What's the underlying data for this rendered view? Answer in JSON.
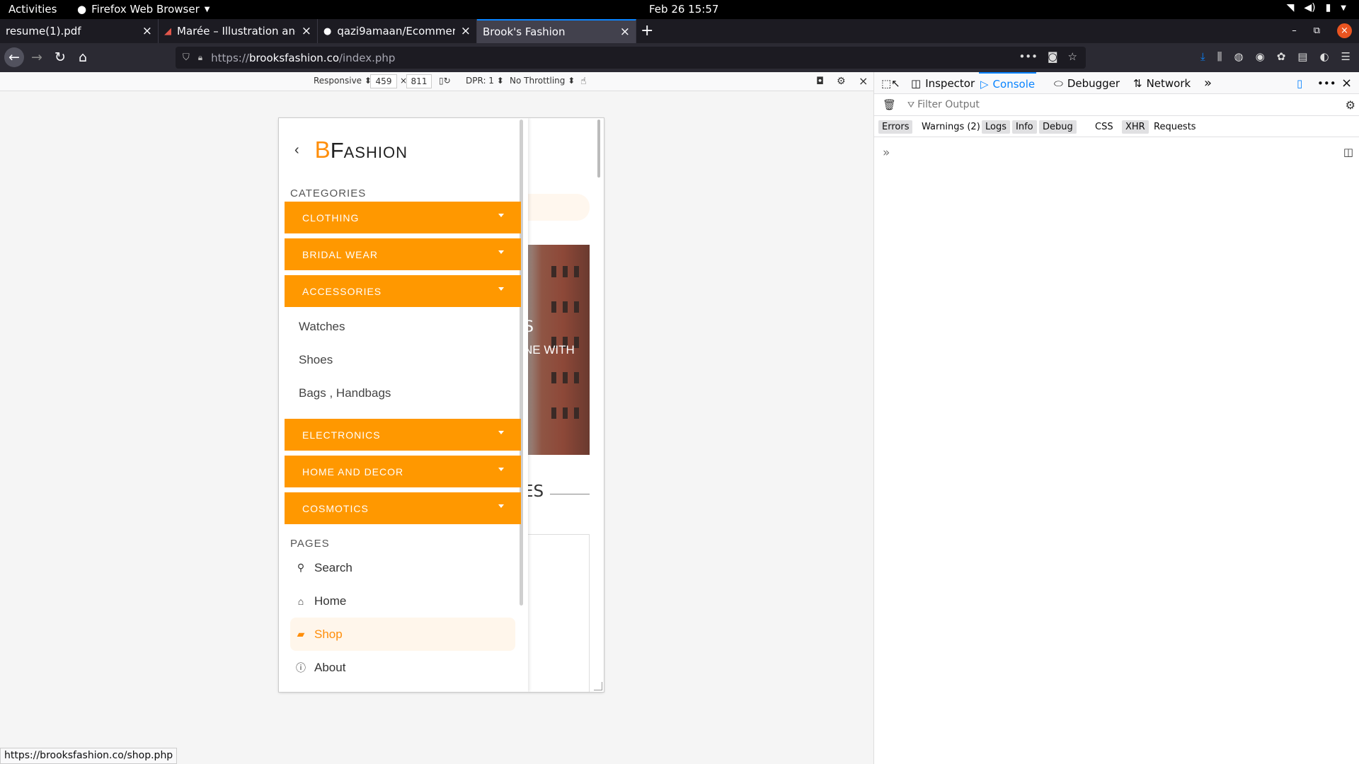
{
  "system": {
    "activities": "Activities",
    "app_menu": "Firefox Web Browser",
    "clock": "Feb 26  15:57"
  },
  "tabs": [
    {
      "title": "resume(1).pdf"
    },
    {
      "title": "Marée – Illustration and D"
    },
    {
      "title": "qazi9amaan/Ecommerce"
    },
    {
      "title": "Brook's Fashion"
    }
  ],
  "address": {
    "prefix": "https://",
    "domain": "brooksfashion.co",
    "path": "/index.php"
  },
  "rdm": {
    "device": "Responsive",
    "width": "459",
    "times": "×",
    "height": "811",
    "dpr": "DPR: 1",
    "throttling": "No Throttling"
  },
  "site": {
    "logo_b": "B",
    "logo_f": "F",
    "logo_rest": "ASHION",
    "categories_title": "CATEGORIES",
    "categories": [
      {
        "label": "CLOTHING"
      },
      {
        "label": "BRIDAL WEAR"
      },
      {
        "label": "ACCESSORIES"
      },
      {
        "label": "ELECTRONICS"
      },
      {
        "label": "HOME AND DECOR"
      },
      {
        "label": "COSMOTICS"
      }
    ],
    "accessories_sub": [
      {
        "label": "Watches"
      },
      {
        "label": "Shoes"
      },
      {
        "label": "Bags , Handbags"
      }
    ],
    "pages_title": "PAGES",
    "pages": [
      {
        "label": "Search",
        "icon": "search-icon"
      },
      {
        "label": "Home",
        "icon": "home-icon"
      },
      {
        "label": "Shop",
        "icon": "shopping-bag-icon"
      },
      {
        "label": "About",
        "icon": "info-icon"
      }
    ],
    "behind": {
      "hero_s": "S",
      "hero_line": "NE WITH",
      "section_es": "ES"
    },
    "accent_color": "#ff9800"
  },
  "devtools": {
    "tabs": [
      {
        "label": "Inspector"
      },
      {
        "label": "Console"
      },
      {
        "label": "Debugger"
      },
      {
        "label": "Network"
      }
    ],
    "filter_placeholder": "Filter Output",
    "filters": [
      {
        "label": "Errors"
      },
      {
        "label": "Warnings (2)"
      },
      {
        "label": "Logs"
      },
      {
        "label": "Info"
      },
      {
        "label": "Debug"
      },
      {
        "label": "CSS"
      },
      {
        "label": "XHR"
      },
      {
        "label": "Requests"
      }
    ]
  },
  "status_url": "https://brooksfashion.co/shop.php"
}
